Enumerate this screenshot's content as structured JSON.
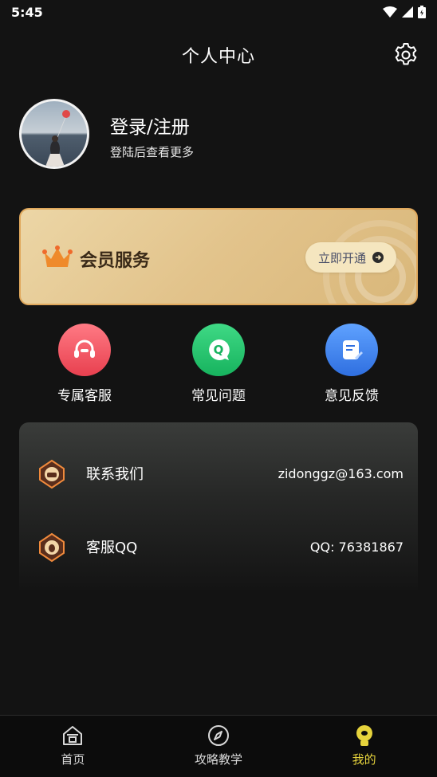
{
  "status_bar": {
    "time": "5:45"
  },
  "header": {
    "title": "个人中心",
    "settings_icon": "gear-icon"
  },
  "profile": {
    "login_title": "登录/注册",
    "login_subtitle": "登陆后查看更多"
  },
  "member": {
    "title": "会员服务",
    "button_label": "立即开通",
    "accent": "#e2c38b"
  },
  "quick_actions": [
    {
      "label": "专属客服",
      "icon": "headset-icon",
      "color": "#f0515e"
    },
    {
      "label": "常见问题",
      "icon": "question-bubble-icon",
      "color": "#22c36d"
    },
    {
      "label": "意见反馈",
      "icon": "edit-note-icon",
      "color": "#3f86f0"
    }
  ],
  "contacts": [
    {
      "label": "联系我们",
      "value": "zidonggz@163.com",
      "icon": "contact-badge-icon"
    },
    {
      "label": "客服QQ",
      "value": "QQ: 76381867",
      "icon": "qq-badge-icon"
    }
  ],
  "tabs": [
    {
      "label": "首页",
      "icon": "home-icon"
    },
    {
      "label": "攻略教学",
      "icon": "compass-icon"
    },
    {
      "label": "我的",
      "icon": "profile-bulb-icon",
      "active": true
    }
  ],
  "colors": {
    "active_tab": "#e6d33c",
    "background": "#131313"
  }
}
